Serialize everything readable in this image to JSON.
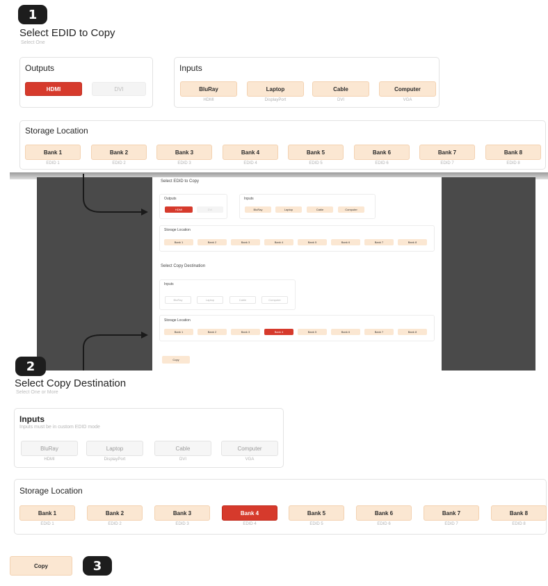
{
  "steps": [
    "1",
    "2",
    "3"
  ],
  "step1": {
    "title": "Select EDID to Copy",
    "subtitle": "Select One",
    "outputs": {
      "label": "Outputs",
      "items": [
        {
          "label": "HDMI",
          "state": "selected"
        },
        {
          "label": "DVI",
          "state": "disabled"
        }
      ]
    },
    "inputs": {
      "label": "Inputs",
      "items": [
        {
          "label": "BluRay",
          "caption": "HDMI"
        },
        {
          "label": "Laptop",
          "caption": "DisplayPort"
        },
        {
          "label": "Cable",
          "caption": "DVI"
        },
        {
          "label": "Computer",
          "caption": "VGA"
        }
      ]
    },
    "storage": {
      "label": "Storage Location",
      "items": [
        {
          "label": "Bank 1",
          "caption": "EDID 1"
        },
        {
          "label": "Bank 2",
          "caption": "EDID 2"
        },
        {
          "label": "Bank 3",
          "caption": "EDID 3"
        },
        {
          "label": "Bank 4",
          "caption": "EDID 4"
        },
        {
          "label": "Bank 5",
          "caption": "EDID 5"
        },
        {
          "label": "Bank 6",
          "caption": "EDID 6"
        },
        {
          "label": "Bank 7",
          "caption": "EDID 7"
        },
        {
          "label": "Bank 8",
          "caption": "EDID 8"
        }
      ]
    }
  },
  "step2": {
    "title": "Select Copy Destination",
    "subtitle": "Select One or More",
    "inputs": {
      "label": "Inputs",
      "note": "Inputs must be in custom EDID mode",
      "items": [
        {
          "label": "BluRay",
          "caption": "HDMI"
        },
        {
          "label": "Laptop",
          "caption": "DisplayPort"
        },
        {
          "label": "Cable",
          "caption": "DVI"
        },
        {
          "label": "Computer",
          "caption": "VGA"
        }
      ]
    },
    "storage": {
      "label": "Storage Location",
      "selected_index": 3,
      "items": [
        {
          "label": "Bank 1",
          "caption": "EDID 1"
        },
        {
          "label": "Bank 2",
          "caption": "EDID 2"
        },
        {
          "label": "Bank 3",
          "caption": "EDID 3"
        },
        {
          "label": "Bank 4",
          "caption": "EDID 4"
        },
        {
          "label": "Bank 5",
          "caption": "EDID 5"
        },
        {
          "label": "Bank 6",
          "caption": "EDID 6"
        },
        {
          "label": "Bank 7",
          "caption": "EDID 7"
        },
        {
          "label": "Bank 8",
          "caption": "EDID 8"
        }
      ]
    }
  },
  "step3": {
    "copy_label": "Copy"
  },
  "colors": {
    "accent_red": "#d63a2c",
    "peach": "#fbe7d2",
    "badge": "#1d1d1d",
    "backdrop": "#4a4a4a"
  }
}
